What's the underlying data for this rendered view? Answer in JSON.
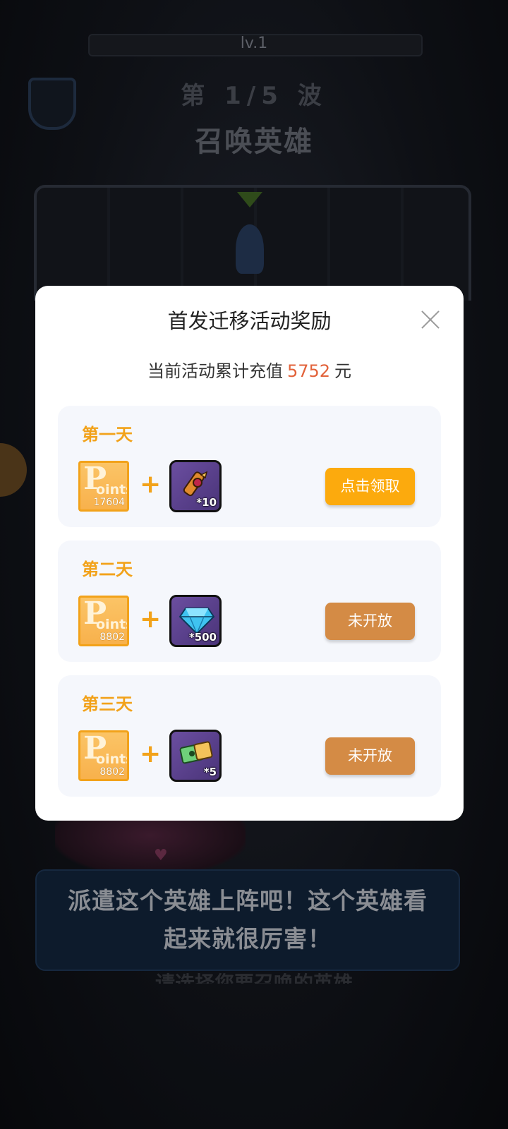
{
  "game": {
    "level": "lv.1",
    "wave": "第 1/5 波",
    "summon": "召唤英雄",
    "speech": "派遣这个英雄上阵吧！这个英雄看起来就很厉害！",
    "hint": "请选择您要召唤的英雄"
  },
  "modal": {
    "title": "首发迁移活动奖励",
    "subtitle_prefix": "当前活动累计充值",
    "amount": "5752",
    "subtitle_suffix": "元",
    "rewards": [
      {
        "day": "第一天",
        "points": "17604",
        "points_label": "Points",
        "plus": "+",
        "item_icon": "scroll-icon",
        "item_qty": "*10",
        "button": "点击领取",
        "state": "claimable"
      },
      {
        "day": "第二天",
        "points": "8802",
        "points_label": "Points",
        "plus": "+",
        "item_icon": "diamond-icon",
        "item_qty": "*500",
        "button": "未开放",
        "state": "locked"
      },
      {
        "day": "第三天",
        "points": "8802",
        "points_label": "Points",
        "plus": "+",
        "item_icon": "ticket-icon",
        "item_qty": "*5",
        "button": "未开放",
        "state": "locked"
      }
    ]
  },
  "colors": {
    "accent_orange": "#f2a21a",
    "claim_button": "#fcaa0d",
    "locked_button": "#d48b45",
    "amount": "#e2623a"
  }
}
